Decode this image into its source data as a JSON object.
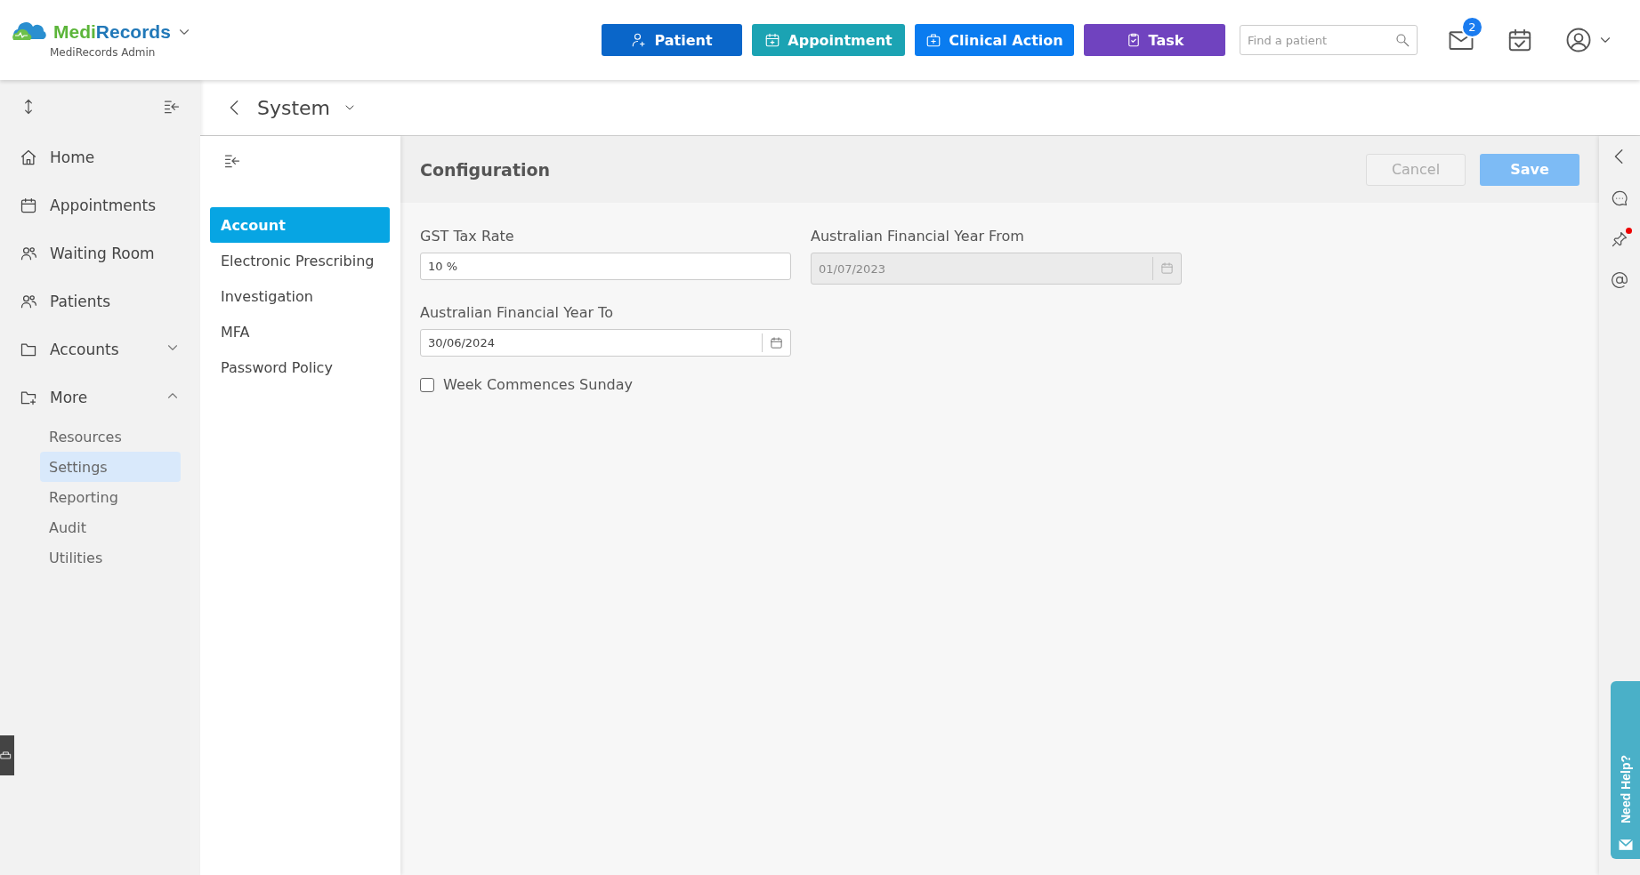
{
  "header": {
    "brand_parts": [
      "Medi",
      "Records"
    ],
    "subtitle": "MediRecords Admin",
    "actions": [
      {
        "label": "Patient",
        "kind": "patient",
        "color": "#0a66c9"
      },
      {
        "label": "Appointment",
        "kind": "appointment",
        "color": "#1ba3b3"
      },
      {
        "label": "Clinical Action",
        "kind": "clinical",
        "color": "#0a7cf0"
      },
      {
        "label": "Task",
        "kind": "task",
        "color": "#7043bf"
      }
    ],
    "search": {
      "placeholder": "Find a patient"
    },
    "mail_badge": "2"
  },
  "sidebar": {
    "items": [
      {
        "label": "Home",
        "kind": "home"
      },
      {
        "label": "Appointments",
        "kind": "calendar"
      },
      {
        "label": "Waiting Room",
        "kind": "waiting"
      },
      {
        "label": "Patients",
        "kind": "patients"
      },
      {
        "label": "Accounts",
        "kind": "folder",
        "expanded": false
      },
      {
        "label": "More",
        "kind": "folder-plus",
        "expanded": true,
        "children": [
          {
            "label": "Resources",
            "selected": false
          },
          {
            "label": "Settings",
            "selected": true
          },
          {
            "label": "Reporting",
            "selected": false
          },
          {
            "label": "Audit",
            "selected": false
          },
          {
            "label": "Utilities",
            "selected": false
          }
        ]
      }
    ]
  },
  "breadcrumb": {
    "title": "System"
  },
  "subnav": {
    "items": [
      {
        "label": "Account",
        "selected": true
      },
      {
        "label": "Electronic Prescribing",
        "selected": false
      },
      {
        "label": "Investigation",
        "selected": false
      },
      {
        "label": "MFA",
        "selected": false
      },
      {
        "label": "Password Policy",
        "selected": false
      }
    ]
  },
  "panel": {
    "title": "Configuration",
    "buttons": [
      {
        "label": "Cancel",
        "kind": "secondary"
      },
      {
        "label": "Save",
        "kind": "primary"
      }
    ],
    "fields": [
      {
        "label": "GST Tax Rate",
        "value": "10 %",
        "kind": "text",
        "disabled": false
      },
      {
        "label": "Australian Financial Year From",
        "value": "01/07/2023",
        "kind": "date",
        "disabled": true
      },
      {
        "label": "Australian Financial Year To",
        "value": "30/06/2024",
        "kind": "date",
        "disabled": false
      }
    ],
    "checkbox": {
      "label": "Week Commences Sunday",
      "checked": false
    }
  },
  "help": {
    "label": "Need Help?"
  }
}
